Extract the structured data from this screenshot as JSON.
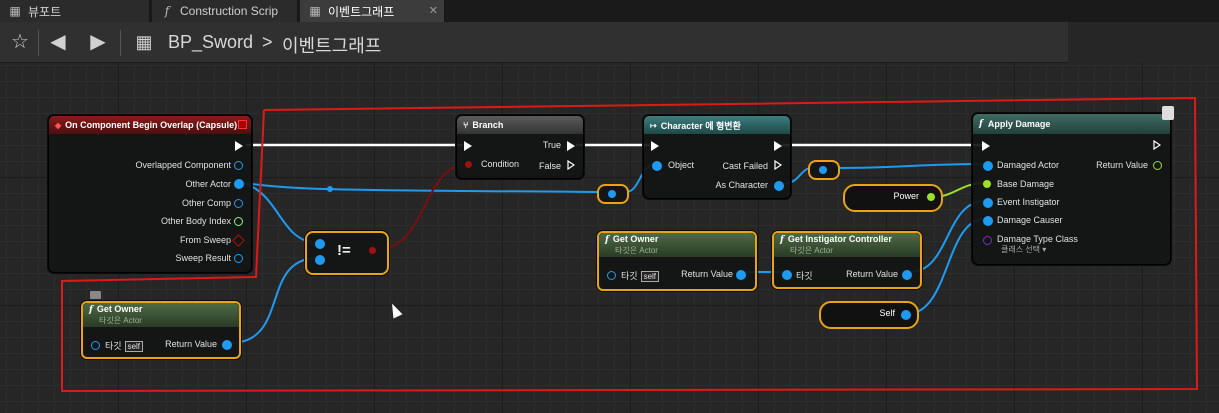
{
  "tabs": [
    {
      "label": "뷰포트",
      "icon": "grid-icon"
    },
    {
      "label": "Construction Scrip",
      "icon": "function-icon"
    },
    {
      "label": "이벤트그래프",
      "icon": "grid-icon"
    }
  ],
  "breadcrumb": {
    "blueprint": "BP_Sword",
    "separator": ">",
    "graph": "이벤트그래프"
  },
  "nodes": {
    "overlap": {
      "title": "On Component Begin Overlap (Capsule)",
      "pins": [
        "Overlapped Component",
        "Other Actor",
        "Other Comp",
        "Other Body Index",
        "From Sweep",
        "Sweep Result"
      ]
    },
    "branch": {
      "title": "Branch",
      "condition": "Condition",
      "true": "True",
      "false": "False"
    },
    "cast": {
      "title": "Character 에 형변환",
      "object": "Object",
      "cast_failed": "Cast Failed",
      "as_character": "As Character"
    },
    "apply_damage": {
      "title": "Apply Damage",
      "inputs": [
        "Damaged Actor",
        "Base Damage",
        "Event Instigator",
        "Damage Causer",
        "Damage Type Class"
      ],
      "return": "Return Value",
      "class_select": "클래스 선택 ▾"
    },
    "get_owner_1": {
      "title": "Get Owner",
      "subtitle": "타깃은 Actor",
      "target": "타깃",
      "self": "self",
      "return": "Return Value"
    },
    "get_owner_2": {
      "title": "Get Owner",
      "subtitle": "타깃은 Actor",
      "target": "타깃",
      "self": "self",
      "return": "Return Value"
    },
    "get_instigator": {
      "title": "Get Instigator Controller",
      "subtitle": "타깃은 Actor",
      "target": "타깃",
      "return": "Return Value"
    },
    "not_equal": {
      "label": "!="
    },
    "power": {
      "label": "Power"
    },
    "self": {
      "label": "Self"
    }
  },
  "colors": {
    "selection": "#e8a317",
    "annotation": "#e01818",
    "object_pin": "#1e9bf0",
    "exec": "#ffffff",
    "float_pin": "#9cdf2b"
  }
}
